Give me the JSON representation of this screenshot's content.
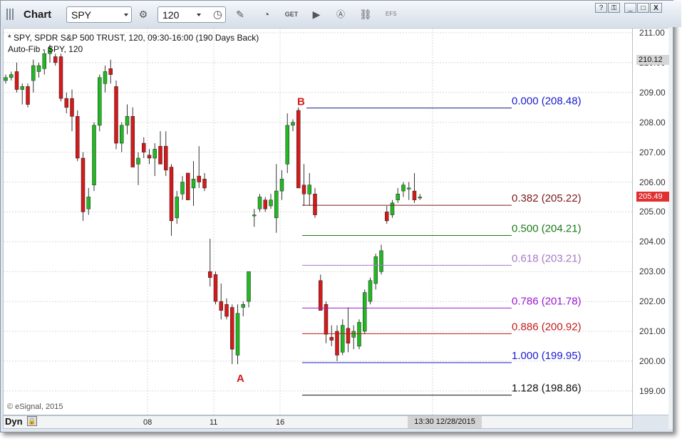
{
  "window": {
    "title": "Chart",
    "symbol": "SPY",
    "interval": "120",
    "efs_label": "EFS",
    "buttons": {
      "help": "?",
      "minimize": "_",
      "maximize": "□",
      "close": "X"
    }
  },
  "toolbar_icons": [
    "settings-icon",
    "clock-icon",
    "pencil-icon",
    "study-icon",
    "get-icon",
    "play-icon",
    "a-icon",
    "link-icon"
  ],
  "chart": {
    "info_line1": "* SPY, SPDR S&P 500 TRUST, 120, 09:30-16:00 (190 Days Back)",
    "info_line2": "Auto-Fib - SPY, 120",
    "copyright": "© eSignal, 2015",
    "dyn_label": "Dyn",
    "cursor_time": "13:30  12/28/2015",
    "x_labels": [
      "08",
      "11",
      "16"
    ],
    "y_ticks": [
      "211.00",
      "210.00",
      "209.00",
      "208.00",
      "207.00",
      "206.00",
      "205.00",
      "204.00",
      "203.00",
      "202.00",
      "201.00",
      "200.00",
      "199.00"
    ],
    "last_price_tag": "210.12",
    "current_price_tag": "205.49",
    "colors": {
      "up": "#22b822",
      "down": "#d41a1a",
      "current_price_bg": "#e03030"
    }
  },
  "chart_data": {
    "type": "candlestick",
    "y_range": [
      198.6,
      211.4
    ],
    "pivot_labels": [
      {
        "label": "A",
        "price": 199.95
      },
      {
        "label": "B",
        "price": 208.48
      }
    ],
    "fib_levels": [
      {
        "ratio": "0.000",
        "price": "208.48",
        "text": "0.000 (208.48)",
        "value": 208.48,
        "line_color": "#1a1a8a",
        "text_color": "#1a1ad0"
      },
      {
        "ratio": "0.382",
        "price": "205.22",
        "text": "0.382 (205.22)",
        "value": 205.22,
        "line_color": "#7a1a1a",
        "text_color": "#7a1a1a"
      },
      {
        "ratio": "0.500",
        "price": "204.21",
        "text": "0.500 (204.21)",
        "value": 204.21,
        "line_color": "#1a7a1a",
        "text_color": "#1a7a1a"
      },
      {
        "ratio": "0.618",
        "price": "203.21",
        "text": "0.618 (203.21)",
        "value": 203.21,
        "line_color": "#a77ac8",
        "text_color": "#a77ac8"
      },
      {
        "ratio": "0.786",
        "price": "201.78",
        "text": "0.786 (201.78)",
        "value": 201.78,
        "line_color": "#9a1ad0",
        "text_color": "#9a1ad0"
      },
      {
        "ratio": "0.886",
        "price": "200.92",
        "text": "0.886 (200.92)",
        "value": 200.92,
        "line_color": "#c01a1a",
        "text_color": "#c01a1a"
      },
      {
        "ratio": "1.000",
        "price": "199.95",
        "text": "1.000 (199.95)",
        "value": 199.95,
        "line_color": "#1a1ad0",
        "text_color": "#1a1ad0"
      },
      {
        "ratio": "1.128",
        "price": "198.86",
        "text": "1.128 (198.86)",
        "value": 198.86,
        "line_color": "#111111",
        "text_color": "#111111"
      }
    ],
    "candles": [
      [
        209.4,
        209.6,
        209.3,
        209.5
      ],
      [
        209.5,
        209.7,
        209.4,
        209.6
      ],
      [
        209.7,
        210.0,
        209.0,
        209.1
      ],
      [
        209.1,
        209.3,
        208.6,
        209.2
      ],
      [
        209.2,
        209.3,
        208.5,
        208.6
      ],
      [
        209.4,
        210.1,
        209.0,
        209.9
      ],
      [
        209.7,
        210.0,
        209.5,
        209.9
      ],
      [
        209.8,
        210.4,
        209.6,
        210.3
      ],
      [
        210.3,
        210.6,
        210.0,
        210.5
      ],
      [
        210.2,
        210.3,
        209.9,
        210.0
      ],
      [
        210.2,
        210.3,
        208.7,
        208.8
      ],
      [
        208.8,
        209.0,
        208.3,
        208.5
      ],
      [
        208.8,
        209.1,
        207.7,
        208.2
      ],
      [
        208.2,
        208.4,
        206.7,
        206.8
      ],
      [
        206.8,
        207.0,
        204.7,
        205.0
      ],
      [
        205.1,
        205.8,
        204.9,
        205.5
      ],
      [
        205.9,
        208.0,
        205.7,
        207.9
      ],
      [
        207.9,
        209.6,
        207.7,
        209.5
      ],
      [
        209.3,
        209.9,
        209.0,
        209.7
      ],
      [
        209.8,
        210.1,
        209.3,
        209.6
      ],
      [
        209.2,
        209.4,
        207.1,
        207.3
      ],
      [
        207.3,
        208.0,
        207.0,
        207.9
      ],
      [
        207.9,
        208.6,
        207.6,
        208.2
      ],
      [
        208.2,
        208.5,
        206.5,
        206.5
      ],
      [
        206.6,
        207.0,
        205.9,
        206.8
      ],
      [
        207.3,
        207.5,
        206.8,
        207.0
      ],
      [
        206.9,
        207.1,
        206.6,
        206.8
      ],
      [
        206.8,
        207.3,
        206.2,
        207.1
      ],
      [
        207.2,
        207.7,
        206.7,
        206.6
      ],
      [
        207.2,
        207.7,
        206.2,
        206.4
      ],
      [
        206.5,
        206.6,
        204.2,
        204.7
      ],
      [
        204.8,
        205.7,
        204.6,
        205.5
      ],
      [
        205.6,
        206.2,
        205.4,
        206.0
      ],
      [
        206.3,
        206.3,
        205.4,
        205.4
      ],
      [
        205.8,
        206.7,
        205.2,
        206.1
      ],
      [
        206.2,
        207.2,
        205.8,
        206.0
      ],
      [
        206.1,
        206.3,
        205.7,
        205.8
      ],
      [
        203.0,
        204.1,
        202.5,
        202.8
      ],
      [
        202.9,
        203.0,
        201.9,
        202.0
      ],
      [
        202.0,
        202.6,
        201.4,
        201.7
      ],
      [
        201.9,
        202.1,
        201.4,
        201.5
      ],
      [
        201.8,
        201.9,
        199.9,
        200.4
      ],
      [
        200.2,
        201.9,
        199.9,
        201.6
      ],
      [
        201.8,
        202.0,
        201.5,
        201.9
      ],
      [
        202.0,
        203.0,
        201.8,
        203.0
      ],
      [
        204.9,
        205.1,
        204.5,
        204.9
      ],
      [
        205.1,
        205.6,
        205.0,
        205.5
      ],
      [
        205.4,
        205.5,
        205.0,
        205.1
      ],
      [
        205.2,
        205.6,
        205.1,
        205.4
      ],
      [
        204.8,
        206.6,
        204.3,
        205.7
      ],
      [
        205.7,
        206.4,
        205.4,
        206.1
      ],
      [
        206.6,
        208.3,
        206.3,
        207.9
      ],
      [
        207.9,
        208.1,
        207.7,
        208.0
      ],
      [
        208.4,
        208.5,
        205.8,
        205.8
      ],
      [
        205.9,
        206.6,
        205.2,
        205.6
      ],
      [
        205.6,
        206.3,
        205.2,
        205.9
      ],
      [
        205.6,
        205.8,
        204.8,
        204.9
      ],
      [
        202.7,
        202.9,
        201.8,
        201.7
      ],
      [
        201.9,
        202.0,
        200.6,
        200.9
      ],
      [
        200.8,
        201.2,
        200.5,
        200.7
      ],
      [
        201.0,
        201.2,
        200.0,
        200.2
      ],
      [
        200.3,
        201.4,
        200.2,
        201.2
      ],
      [
        201.1,
        201.8,
        200.3,
        200.6
      ],
      [
        200.8,
        201.2,
        200.4,
        201.0
      ],
      [
        200.5,
        201.4,
        200.4,
        201.3
      ],
      [
        201.0,
        202.4,
        200.9,
        202.3
      ],
      [
        202.0,
        202.8,
        201.9,
        202.7
      ],
      [
        202.6,
        203.6,
        202.4,
        203.5
      ],
      [
        203.0,
        203.9,
        202.9,
        203.7
      ],
      [
        205.0,
        205.2,
        204.6,
        204.7
      ],
      [
        204.9,
        205.4,
        204.8,
        205.3
      ],
      [
        205.4,
        205.8,
        205.3,
        205.6
      ],
      [
        205.7,
        206.0,
        205.5,
        205.9
      ],
      [
        205.8,
        206.0,
        205.4,
        205.8
      ],
      [
        205.7,
        206.3,
        205.3,
        205.4
      ],
      [
        205.5,
        205.6,
        205.4,
        205.5
      ]
    ]
  }
}
